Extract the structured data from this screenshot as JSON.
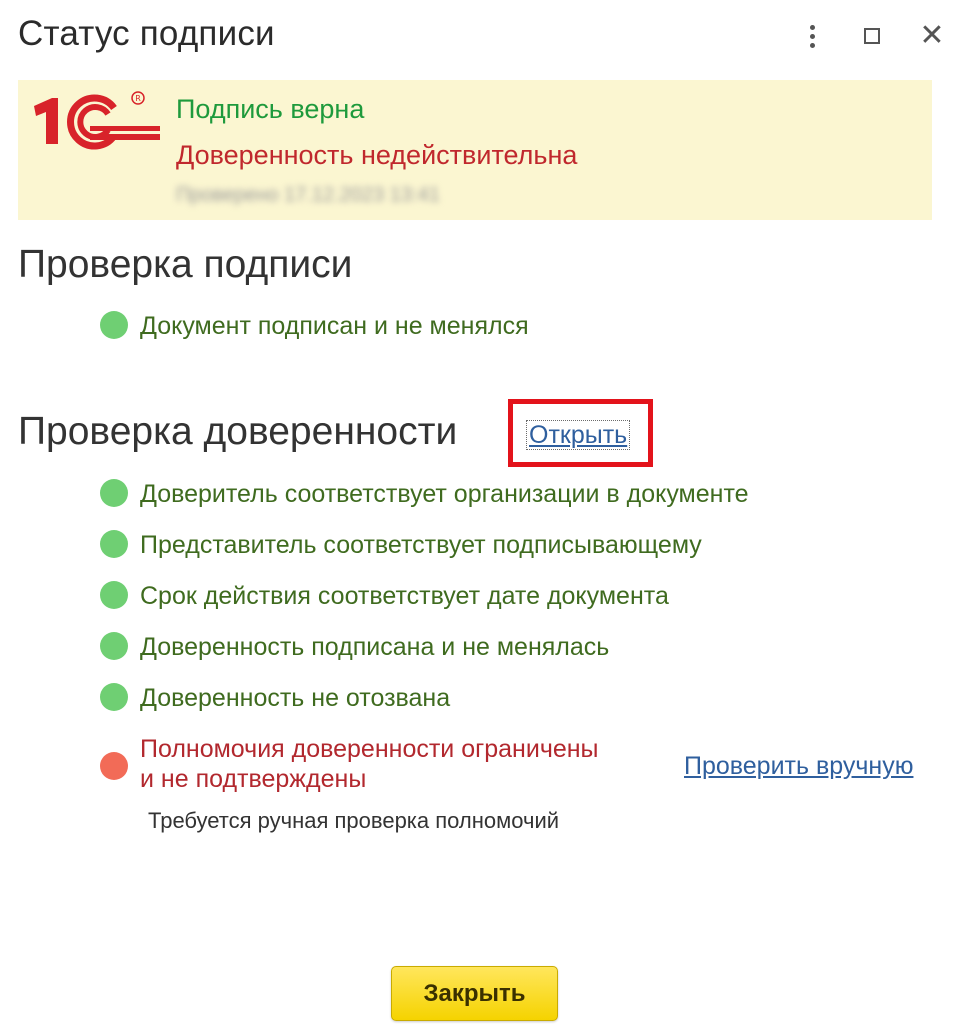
{
  "window": {
    "title": "Статус подписи",
    "menu_icon": "more-vertical-icon",
    "maximize_icon": "maximize-icon",
    "close_icon": "close-icon"
  },
  "banner": {
    "logo": "1c-logo",
    "signature_status": "Подпись верна",
    "poa_status": "Доверенность недействительна",
    "blurred_text": "Проверено 17.12.2023 13:41"
  },
  "signature_check": {
    "heading": "Проверка подписи",
    "items": [
      {
        "label": "Документ подписан и не менялся",
        "status": "ok"
      }
    ]
  },
  "poa_check": {
    "heading": "Проверка доверенности",
    "open_link": "Открыть",
    "items": [
      {
        "label": "Доверитель соответствует организации в документе",
        "status": "ok"
      },
      {
        "label": "Представитель соответствует подписывающему",
        "status": "ok"
      },
      {
        "label": "Срок действия соответствует дате документа",
        "status": "ok"
      },
      {
        "label": "Доверенность подписана и не менялась",
        "status": "ok"
      },
      {
        "label": "Доверенность не отозвана",
        "status": "ok"
      },
      {
        "label_line1": "Полномочия доверенности ограничены",
        "label_line2": "и не подтверждены",
        "status": "error"
      }
    ],
    "manual_check_link": "Проверить вручную",
    "note": "Требуется ручная проверка полномочий"
  },
  "footer": {
    "close_label": "Закрыть"
  },
  "colors": {
    "ok_green": "#6fcf73",
    "error_red": "#f26b57",
    "highlight_frame": "#e3131b",
    "banner_bg": "#fbf6d1",
    "button_yellow": "#f5d300"
  }
}
